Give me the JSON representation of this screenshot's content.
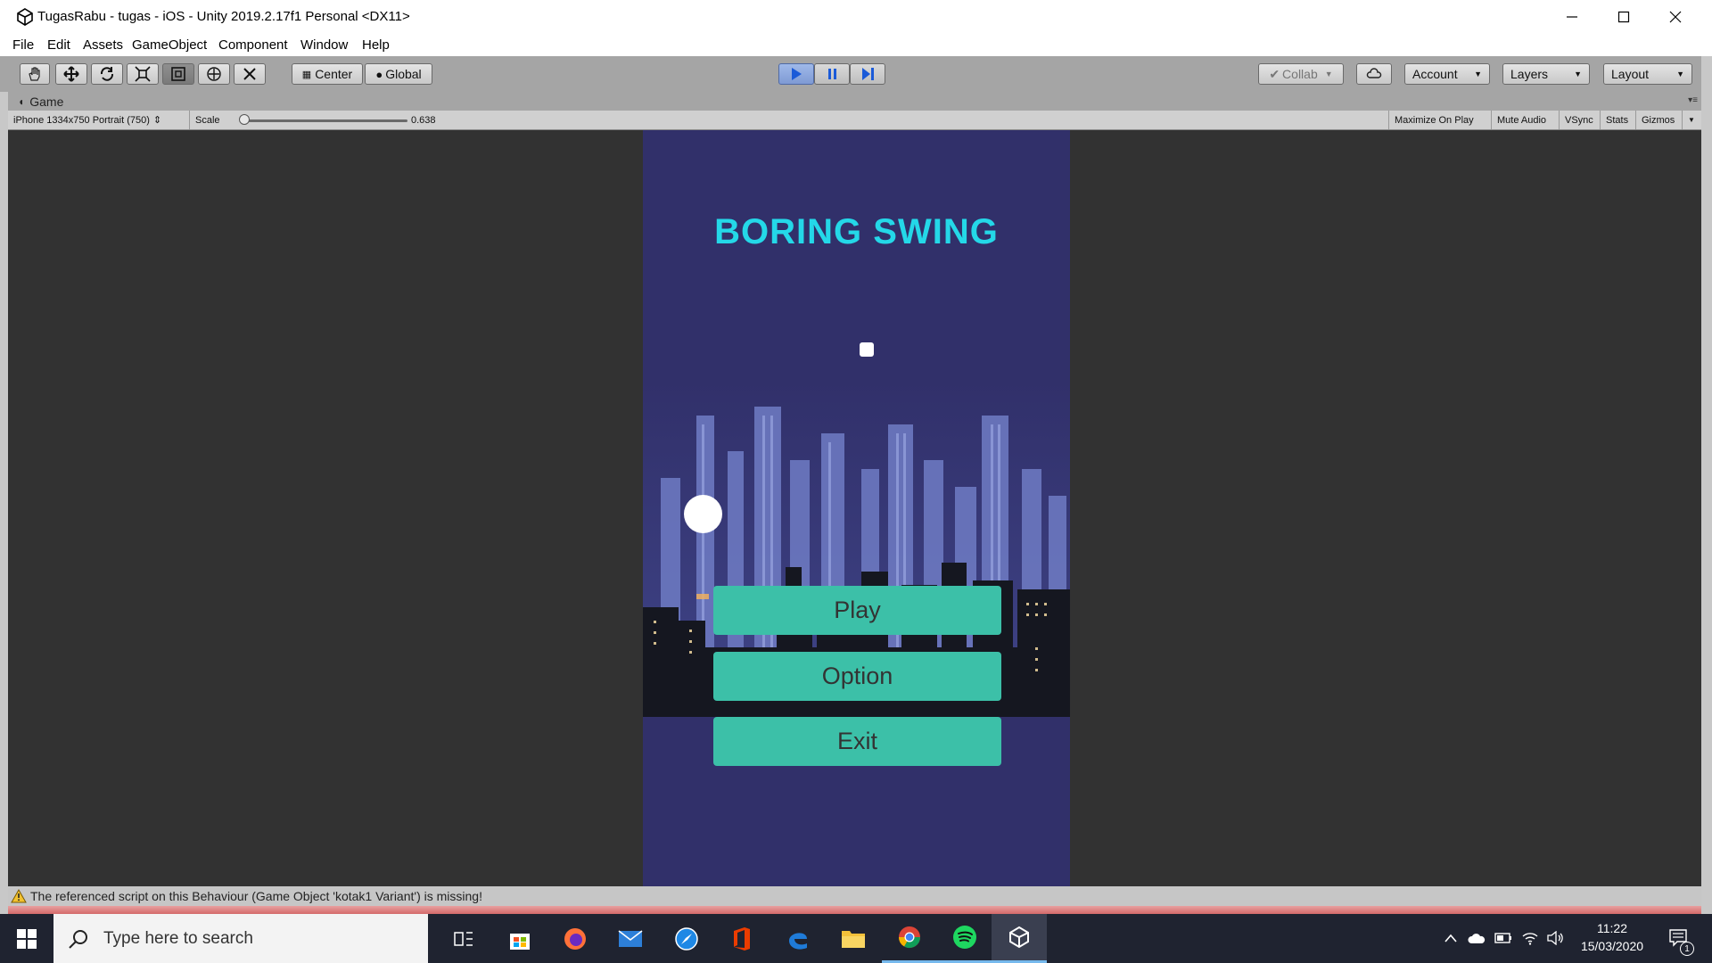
{
  "window": {
    "title": "TugasRabu - tugas - iOS - Unity 2019.2.17f1 Personal <DX11>"
  },
  "menu": [
    "File",
    "Edit",
    "Assets",
    "GameObject",
    "Component",
    "Window",
    "Help"
  ],
  "toolbar": {
    "pivot_label": "Center",
    "space_label": "Global",
    "collab_label": "Collab",
    "account_label": "Account",
    "layers_label": "Layers",
    "layout_label": "Layout"
  },
  "game_tab": {
    "label": "Game"
  },
  "game_bar": {
    "resolution": "iPhone 1334x750 Portrait (750)",
    "scale_label": "Scale",
    "scale_value": "0.638",
    "scale_fraction": 0.0,
    "maximize": "Maximize On Play",
    "mute": "Mute Audio",
    "vsync": "VSync",
    "stats": "Stats",
    "gizmos": "Gizmos"
  },
  "game": {
    "title": "BORING SWING",
    "buttons": {
      "play": "Play",
      "option": "Option",
      "exit": "Exit"
    }
  },
  "status": {
    "message": "The referenced script on this Behaviour (Game Object 'kotak1 Variant') is missing!"
  },
  "taskbar": {
    "search_placeholder": "Type here to search",
    "time": "11:22",
    "date": "15/03/2020",
    "notification_count": "1"
  },
  "colors": {
    "game_bg": "#31306a",
    "title": "#24d8e8",
    "button": "#3cc0a8",
    "play_active": "#7f9ad4"
  }
}
